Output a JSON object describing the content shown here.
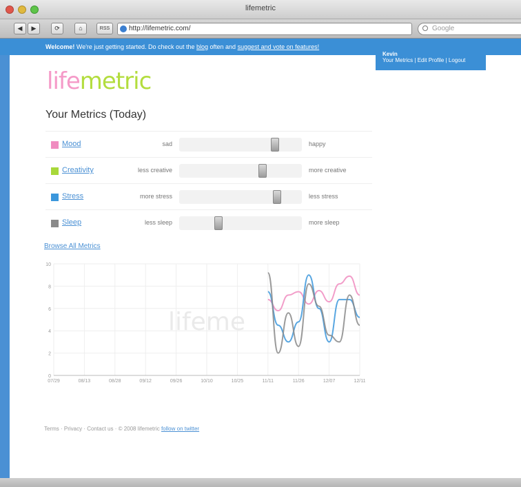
{
  "window": {
    "title": "lifemetric"
  },
  "toolbar": {
    "back_label": "◀",
    "forward_label": "▶",
    "reload_label": "⟳",
    "home_label": "⌂",
    "rss_label": "RSS",
    "address_value": "http://lifemetric.com/",
    "search_placeholder": "Google"
  },
  "welcome": {
    "prefix": "Welcome!",
    "message": " We're just getting started. Do check out the ",
    "blog_label": "blog",
    "middle": " often and ",
    "suggest_label": "suggest and vote on features!"
  },
  "user_menu": {
    "name": "Kevin",
    "links": "Your Metrics | Edit Profile | Logout"
  },
  "logo": {
    "part1": "life",
    "part2": "metric"
  },
  "section_title": "Your Metrics (Today)",
  "metrics": [
    {
      "name": "Mood",
      "low": "sad",
      "high": "happy",
      "color": "#f08cc0",
      "value": 0.78
    },
    {
      "name": "Creativity",
      "low": "less creative",
      "high": "more creative",
      "color": "#a8d83a",
      "value": 0.68
    },
    {
      "name": "Stress",
      "low": "more stress",
      "high": "less stress",
      "color": "#3b97dc",
      "value": 0.8
    },
    {
      "name": "Sleep",
      "low": "less sleep",
      "high": "more sleep",
      "color": "#8a8a8a",
      "value": 0.32
    }
  ],
  "browse_link": "Browse All Metrics",
  "chart_data": {
    "type": "line",
    "x": [
      "07/29",
      "08/03",
      "08/08",
      "08/13",
      "08/18",
      "08/23",
      "08/28",
      "09/02",
      "09/07",
      "09/12",
      "09/17",
      "09/21",
      "09/26",
      "10/01",
      "10/05",
      "10/10",
      "10/15",
      "10/19",
      "10/24",
      "10/29",
      "11/03",
      "11/08",
      "11/11",
      "11/16",
      "11/19",
      "11/22",
      "11/24",
      "11/26",
      "11/28",
      "11/30",
      "12/01"
    ],
    "xticks": [
      "07/29",
      "08/13",
      "08/28",
      "09/12",
      "09/26",
      "10/10",
      "10/25",
      "11/11",
      "11/26",
      "12/07",
      "12/11"
    ],
    "yticks": [
      "0",
      "2",
      "4",
      "6",
      "8",
      "10"
    ],
    "ylim": [
      0,
      10
    ],
    "watermark": "lifeme",
    "series": [
      {
        "name": "Mood",
        "color": "#f08cc0",
        "values": [
          null,
          null,
          null,
          null,
          null,
          null,
          null,
          null,
          null,
          null,
          null,
          null,
          null,
          null,
          null,
          null,
          null,
          null,
          null,
          null,
          null,
          6.8,
          5.8,
          7.2,
          7.5,
          6.4,
          7.6,
          6.6,
          8.2,
          8.9,
          7.2
        ]
      },
      {
        "name": "Stress",
        "color": "#3b97dc",
        "values": [
          null,
          null,
          null,
          null,
          null,
          null,
          null,
          null,
          null,
          null,
          null,
          null,
          null,
          null,
          null,
          null,
          null,
          null,
          null,
          null,
          null,
          7.5,
          4.5,
          3.0,
          4.8,
          9.0,
          6.0,
          3.0,
          6.8,
          6.8,
          5.2
        ]
      },
      {
        "name": "Sleep",
        "color": "#8a8a8a",
        "values": [
          null,
          null,
          null,
          null,
          null,
          null,
          null,
          null,
          null,
          null,
          null,
          null,
          null,
          null,
          null,
          null,
          null,
          null,
          null,
          null,
          null,
          9.2,
          2.0,
          5.6,
          2.6,
          8.2,
          6.2,
          3.6,
          3.0,
          7.2,
          4.5
        ]
      }
    ]
  },
  "footer": {
    "links": "Terms · Privacy · Contact us",
    "credit": " · © 2008 lifemetric ",
    "twitter_label": "follow on twitter"
  }
}
